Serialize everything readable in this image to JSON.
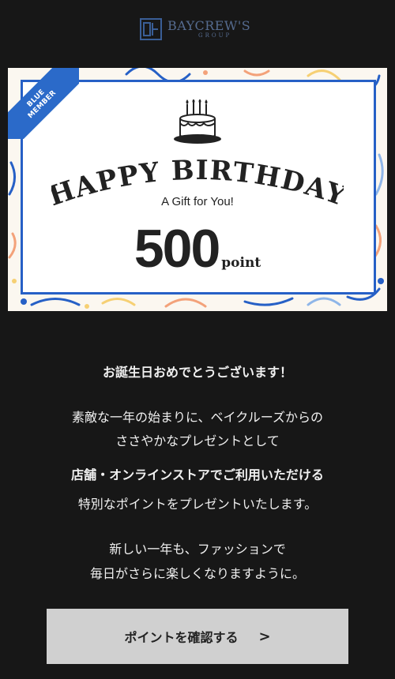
{
  "header": {
    "logo_icon": "baycrews-mark",
    "brand": "BAYCREW'S",
    "brand_sub": "GROUP"
  },
  "card": {
    "badge_line1": "BLUE",
    "badge_line2": "MEMBER",
    "title": "HAPPY BIRTHDAY",
    "subtitle": "A Gift for You!",
    "points_value": "500",
    "points_unit": "point",
    "cake_icon": "birthday-cake-icon"
  },
  "message": {
    "heading": "お誕生日おめでとうございます！",
    "line1": "素敵な一年の始まりに、ベイクルーズからの",
    "line2": "ささやかなプレゼントとして",
    "line3": "店舗・オンラインストアでご利用いただける",
    "line4": "特別なポイントをプレゼントいたします。",
    "line5": "新しい一年も、ファッションで",
    "line6": "毎日がさらに楽しくなりますように。"
  },
  "cta": {
    "label": "ポイントを確認する",
    "arrow": ">"
  },
  "colors": {
    "background": "#171717",
    "accent_blue": "#2660c6",
    "button_bg": "#d0d0d0"
  }
}
